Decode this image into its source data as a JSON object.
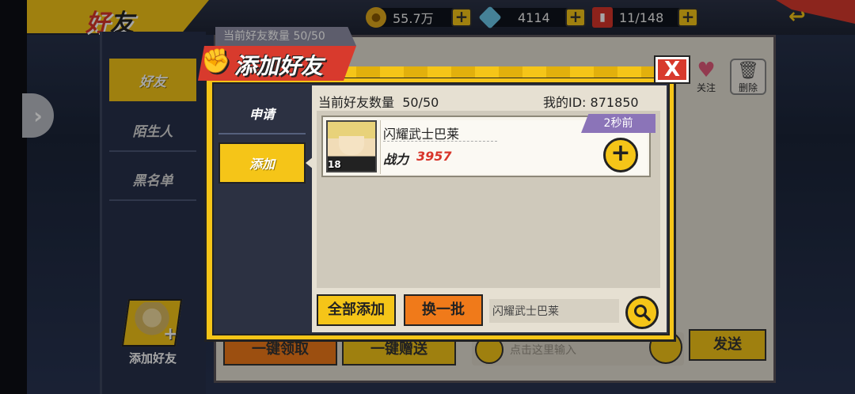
{
  "header": {
    "title_part1": "好",
    "title_part2": "友",
    "resources": [
      {
        "name": "gold-coin-icon",
        "value": "55.7万"
      },
      {
        "name": "diamond-icon",
        "value": "4114"
      },
      {
        "name": "stamina-icon",
        "value": "11/148"
      }
    ],
    "plus_label": "+"
  },
  "left_tabs": [
    "好友",
    "陌生人",
    "黑名单"
  ],
  "add_friend_side_label": "添加好友",
  "bg_panel": {
    "count": "当前好友数量 50/50",
    "follow_label": "关注",
    "delete_label": "删除",
    "oneclick_claim": "一键领取",
    "oneclick_gift": "一键赠送",
    "input_hint": "点击这里输入",
    "send_label": "发送"
  },
  "dialog": {
    "title": "添加好友",
    "close_label": "X",
    "tabs": [
      "申请",
      "添加"
    ],
    "count_label": "当前好友数量",
    "count_value": "50/50",
    "my_id_label": "我的ID:",
    "my_id_value": "871850",
    "friend": {
      "name": "闪耀武士巴莱",
      "level": "18",
      "power_label": "战力",
      "power_value": "3957",
      "time": "2秒前",
      "add_label": "+"
    },
    "add_all_label": "全部添加",
    "refresh_label": "换一批",
    "search_value": "闪耀武士巴莱"
  },
  "colors": {
    "accent_yellow": "#f5c518",
    "accent_red": "#d83a2d",
    "accent_orange": "#f07a1a",
    "panel_beige": "#e6e0d2"
  }
}
